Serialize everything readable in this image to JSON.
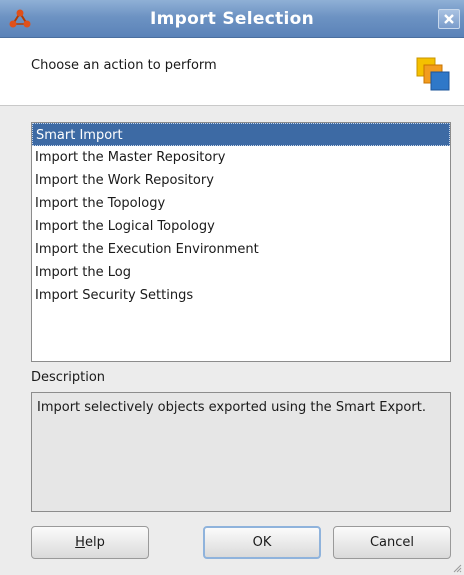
{
  "window": {
    "title": "Import Selection",
    "close_glyph": "×"
  },
  "header": {
    "prompt": "Choose an action to perform"
  },
  "actions": {
    "items": [
      {
        "label": "Smart Import",
        "selected": true
      },
      {
        "label": "Import the Master Repository",
        "selected": false
      },
      {
        "label": "Import the Work Repository",
        "selected": false
      },
      {
        "label": "Import the Topology",
        "selected": false
      },
      {
        "label": "Import the Logical Topology",
        "selected": false
      },
      {
        "label": "Import the Execution Environment",
        "selected": false
      },
      {
        "label": "Import the Log",
        "selected": false
      },
      {
        "label": "Import Security Settings",
        "selected": false
      }
    ]
  },
  "description": {
    "label": "Description",
    "text": "Import selectively objects exported using the Smart Export."
  },
  "buttons": {
    "help_mnemonic": "H",
    "help_rest": "elp",
    "ok": "OK",
    "cancel": "Cancel"
  },
  "colors": {
    "titlebar": "#6d93c3",
    "selection": "#3d6aa4",
    "dialog_bg": "#ececec"
  },
  "icons": {
    "app": "odi-app-icon",
    "header": "import-wizard-icon",
    "close": "close-icon"
  }
}
